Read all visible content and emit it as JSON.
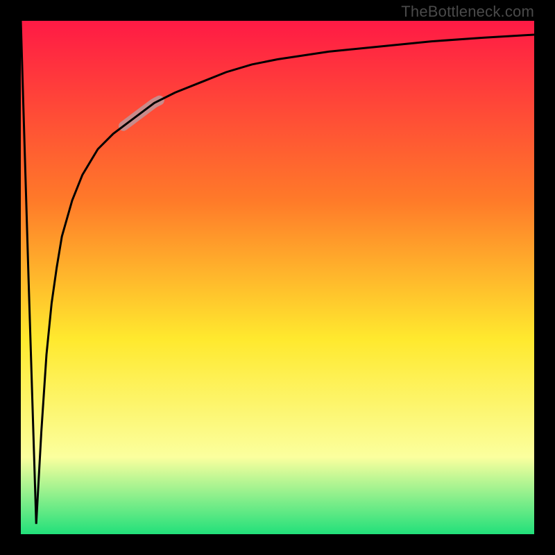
{
  "attribution": "TheBottleneck.com",
  "colors": {
    "frame": "#000000",
    "grad_top": "#ff1a45",
    "grad_mid1": "#ff7a29",
    "grad_mid2": "#ffe92e",
    "grad_mid3": "#fbff9e",
    "grad_bottom": "#21e07a",
    "curve": "#000000",
    "highlight": "#c88b8b"
  },
  "chart_data": {
    "type": "line",
    "title": "",
    "xlabel": "",
    "ylabel": "",
    "xlim": [
      0,
      100
    ],
    "ylim": [
      0,
      100
    ],
    "grid": false,
    "legend": false,
    "series": [
      {
        "name": "bottleneck-curve",
        "x": [
          0,
          1.5,
          3,
          4,
          5,
          6,
          7,
          8,
          10,
          12,
          15,
          18,
          22,
          26,
          30,
          35,
          40,
          45,
          50,
          60,
          70,
          80,
          90,
          100
        ],
        "y": [
          100,
          50,
          2,
          20,
          35,
          45,
          52,
          58,
          65,
          70,
          75,
          78,
          81,
          84,
          86,
          88,
          90,
          91.5,
          92.5,
          94,
          95,
          96,
          96.7,
          97.3
        ]
      }
    ],
    "highlight_segment": {
      "series": "bottleneck-curve",
      "x_start": 20,
      "x_end": 27
    }
  }
}
